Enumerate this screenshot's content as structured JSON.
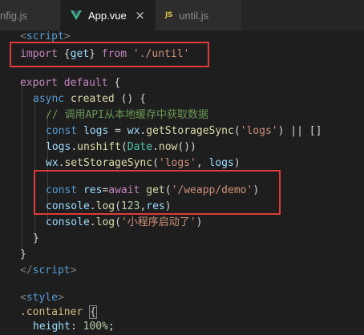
{
  "tabs": [
    {
      "label": "nfig.js",
      "active": false
    },
    {
      "label": "App.vue",
      "active": true,
      "close": "×"
    },
    {
      "label": "until.js",
      "active": false,
      "icon_text": "JS"
    }
  ],
  "code": {
    "l1": {
      "open": "<",
      "tag": "script",
      "close": ">"
    },
    "l2": {
      "kw": "import",
      "brace_open": " {",
      "name": "get",
      "brace_close": "} ",
      "from": "from",
      "sp": " ",
      "path": "'./until'"
    },
    "l4": {
      "export": "export",
      "default": " default",
      "brace": " {"
    },
    "l5": {
      "async": "async",
      "name": " created",
      "rest": " () {"
    },
    "l6": {
      "comment": "// 调用API从本地缓存中获取数据"
    },
    "l7": {
      "const": "const",
      "v": " logs",
      "eq": " = ",
      "obj": "wx",
      "dot": ".",
      "fn": "getStorageSync",
      "p1": "(",
      "s": "'logs'",
      "p2": ") || []"
    },
    "l8": {
      "v": "logs",
      "dot": ".",
      "fn": "unshift",
      "p1": "(",
      "cls": "Date",
      "dot2": ".",
      "fn2": "now",
      "p2": "())"
    },
    "l9": {
      "obj": "wx",
      "dot": ".",
      "fn": "setStorageSync",
      "p1": "(",
      "s": "'logs'",
      "comma": ", ",
      "v": "logs",
      "p2": ")"
    },
    "l11": {
      "const": "const",
      "v": " res",
      "eq": "=",
      "await": "await",
      "sp": " ",
      "fn": "get",
      "p1": "(",
      "s": "'/weapp/demo'",
      "p2": ")"
    },
    "l12": {
      "obj": "console",
      "dot": ".",
      "fn": "log",
      "p1": "(",
      "n": "123",
      "comma": ",",
      "v": "res",
      "p2": ")"
    },
    "l13": {
      "obj": "console",
      "dot": ".",
      "fn": "log",
      "p1": "(",
      "s": "'小程序启动了'",
      "p2": ")"
    },
    "l14": {
      "t": "}"
    },
    "l15": {
      "t": "}"
    },
    "l16": {
      "open": "</",
      "tag": "script",
      "close": ">"
    },
    "l18": {
      "open": "<",
      "tag": "style",
      "close": ">"
    },
    "l19": {
      "sel": ".container",
      "sp": " ",
      "brace": "{"
    },
    "l20": {
      "prop": "height",
      "colon": ": ",
      "n": "100%",
      "semi": ";"
    }
  }
}
